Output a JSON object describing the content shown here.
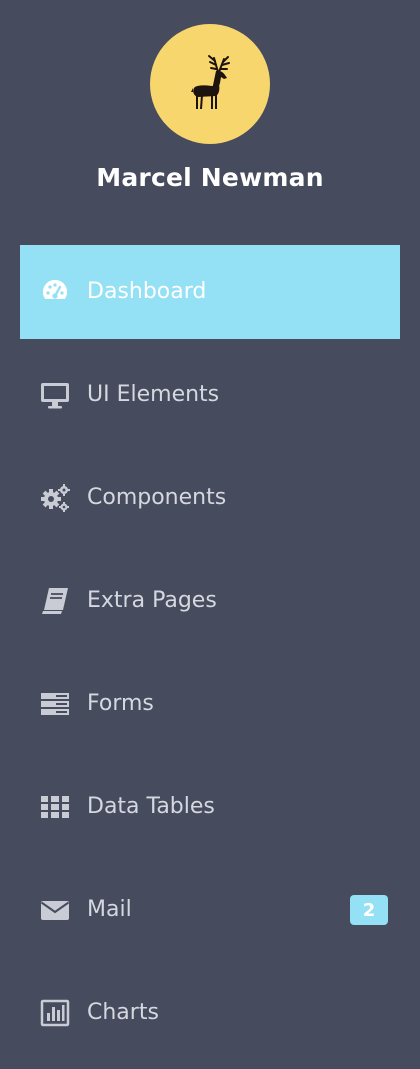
{
  "profile": {
    "name": "Marcel Newman",
    "avatar_icon": "elk-icon",
    "avatar_color": "#f8d66e"
  },
  "colors": {
    "sidebar_bg": "#464b5e",
    "active_bg": "#94e0f4",
    "text": "#d6d8df",
    "icon": "#c9ccd4"
  },
  "nav": {
    "items": [
      {
        "label": "Dashboard",
        "icon": "dashboard-gauge-icon",
        "active": true
      },
      {
        "label": "UI Elements",
        "icon": "monitor-icon",
        "active": false
      },
      {
        "label": "Components",
        "icon": "gears-icon",
        "active": false
      },
      {
        "label": "Extra Pages",
        "icon": "book-icon",
        "active": false
      },
      {
        "label": "Forms",
        "icon": "form-rows-icon",
        "active": false
      },
      {
        "label": "Data Tables",
        "icon": "grid-icon",
        "active": false
      },
      {
        "label": "Mail",
        "icon": "envelope-icon",
        "active": false,
        "badge": "2"
      },
      {
        "label": "Charts",
        "icon": "bar-chart-icon",
        "active": false
      }
    ]
  }
}
